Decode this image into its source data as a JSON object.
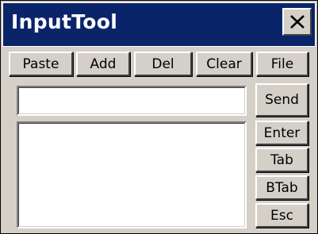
{
  "window": {
    "title": "InputTool"
  },
  "toolbar": {
    "paste": "Paste",
    "add": "Add",
    "del": "Del",
    "clear": "Clear",
    "file": "File"
  },
  "side": {
    "send": "Send",
    "enter": "Enter",
    "tab": "Tab",
    "btab": "BTab",
    "esc": "Esc"
  },
  "input": {
    "value": "",
    "text_area_value": ""
  },
  "icons": {
    "close": "close-icon"
  },
  "colors": {
    "titlebar": "#0a246a",
    "face": "#d4d0c8"
  }
}
